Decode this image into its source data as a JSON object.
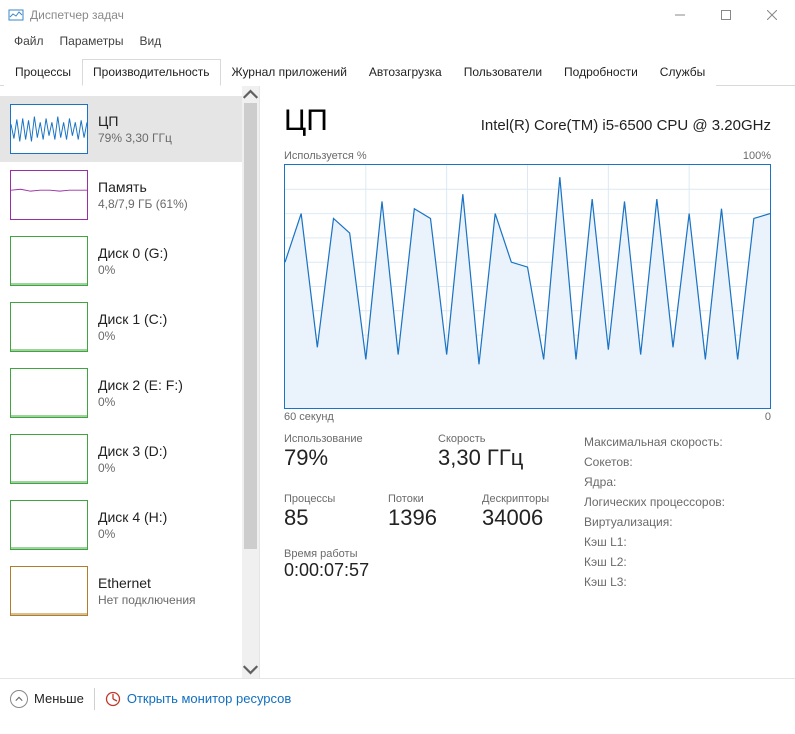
{
  "window": {
    "title": "Диспетчер задач"
  },
  "menu": {
    "file": "Файл",
    "options": "Параметры",
    "view": "Вид"
  },
  "tabs": {
    "processes": "Процессы",
    "performance": "Производительность",
    "apphistory": "Журнал приложений",
    "startup": "Автозагрузка",
    "users": "Пользователи",
    "details": "Подробности",
    "services": "Службы"
  },
  "sidebar": {
    "items": [
      {
        "title": "ЦП",
        "sub": "79% 3,30 ГГц",
        "kind": "cpu"
      },
      {
        "title": "Память",
        "sub": "4,8/7,9 ГБ (61%)",
        "kind": "mem"
      },
      {
        "title": "Диск 0 (G:)",
        "sub": "0%",
        "kind": "disk"
      },
      {
        "title": "Диск 1 (C:)",
        "sub": "0%",
        "kind": "disk"
      },
      {
        "title": "Диск 2 (E: F:)",
        "sub": "0%",
        "kind": "disk"
      },
      {
        "title": "Диск 3 (D:)",
        "sub": "0%",
        "kind": "disk"
      },
      {
        "title": "Диск 4 (H:)",
        "sub": "0%",
        "kind": "disk"
      },
      {
        "title": "Ethernet",
        "sub": "Нет подключения",
        "kind": "net"
      }
    ]
  },
  "detail": {
    "title": "ЦП",
    "cpu_name": "Intel(R) Core(TM) i5-6500 CPU @ 3.20GHz",
    "chart_label_left": "Используется %",
    "chart_label_right": "100%",
    "chart_bottom_left": "60 секунд",
    "chart_bottom_right": "0",
    "stats": {
      "util_label": "Использование",
      "util_value": "79%",
      "speed_label": "Скорость",
      "speed_value": "3,30 ГГц",
      "proc_label": "Процессы",
      "proc_value": "85",
      "threads_label": "Потоки",
      "threads_value": "1396",
      "handles_label": "Дескрипторы",
      "handles_value": "34006",
      "uptime_label": "Время работы",
      "uptime_value": "0:00:07:57"
    },
    "right": {
      "max_speed": "Максимальная скорость:",
      "sockets": "Сокетов:",
      "cores": "Ядра:",
      "logical": "Логических процессоров:",
      "virt": "Виртуализация:",
      "l1": "Кэш L1:",
      "l2": "Кэш L2:",
      "l3": "Кэш L3:"
    }
  },
  "footer": {
    "fewer": "Меньше",
    "resmon": "Открыть монитор ресурсов"
  },
  "chart_data": {
    "type": "line",
    "title": "Используется %",
    "xlabel": "60 секунд",
    "ylabel": "%",
    "ylim": [
      0,
      100
    ],
    "xlim": [
      60,
      0
    ],
    "x": [
      60,
      58,
      56,
      54,
      52,
      50,
      48,
      46,
      44,
      42,
      40,
      38,
      36,
      34,
      32,
      30,
      28,
      26,
      24,
      22,
      20,
      18,
      16,
      14,
      12,
      10,
      8,
      6,
      4,
      2,
      0
    ],
    "values": [
      60,
      80,
      25,
      78,
      72,
      20,
      85,
      22,
      82,
      78,
      22,
      88,
      18,
      80,
      60,
      58,
      20,
      95,
      20,
      86,
      24,
      85,
      22,
      86,
      25,
      80,
      20,
      82,
      20,
      78,
      80
    ]
  }
}
